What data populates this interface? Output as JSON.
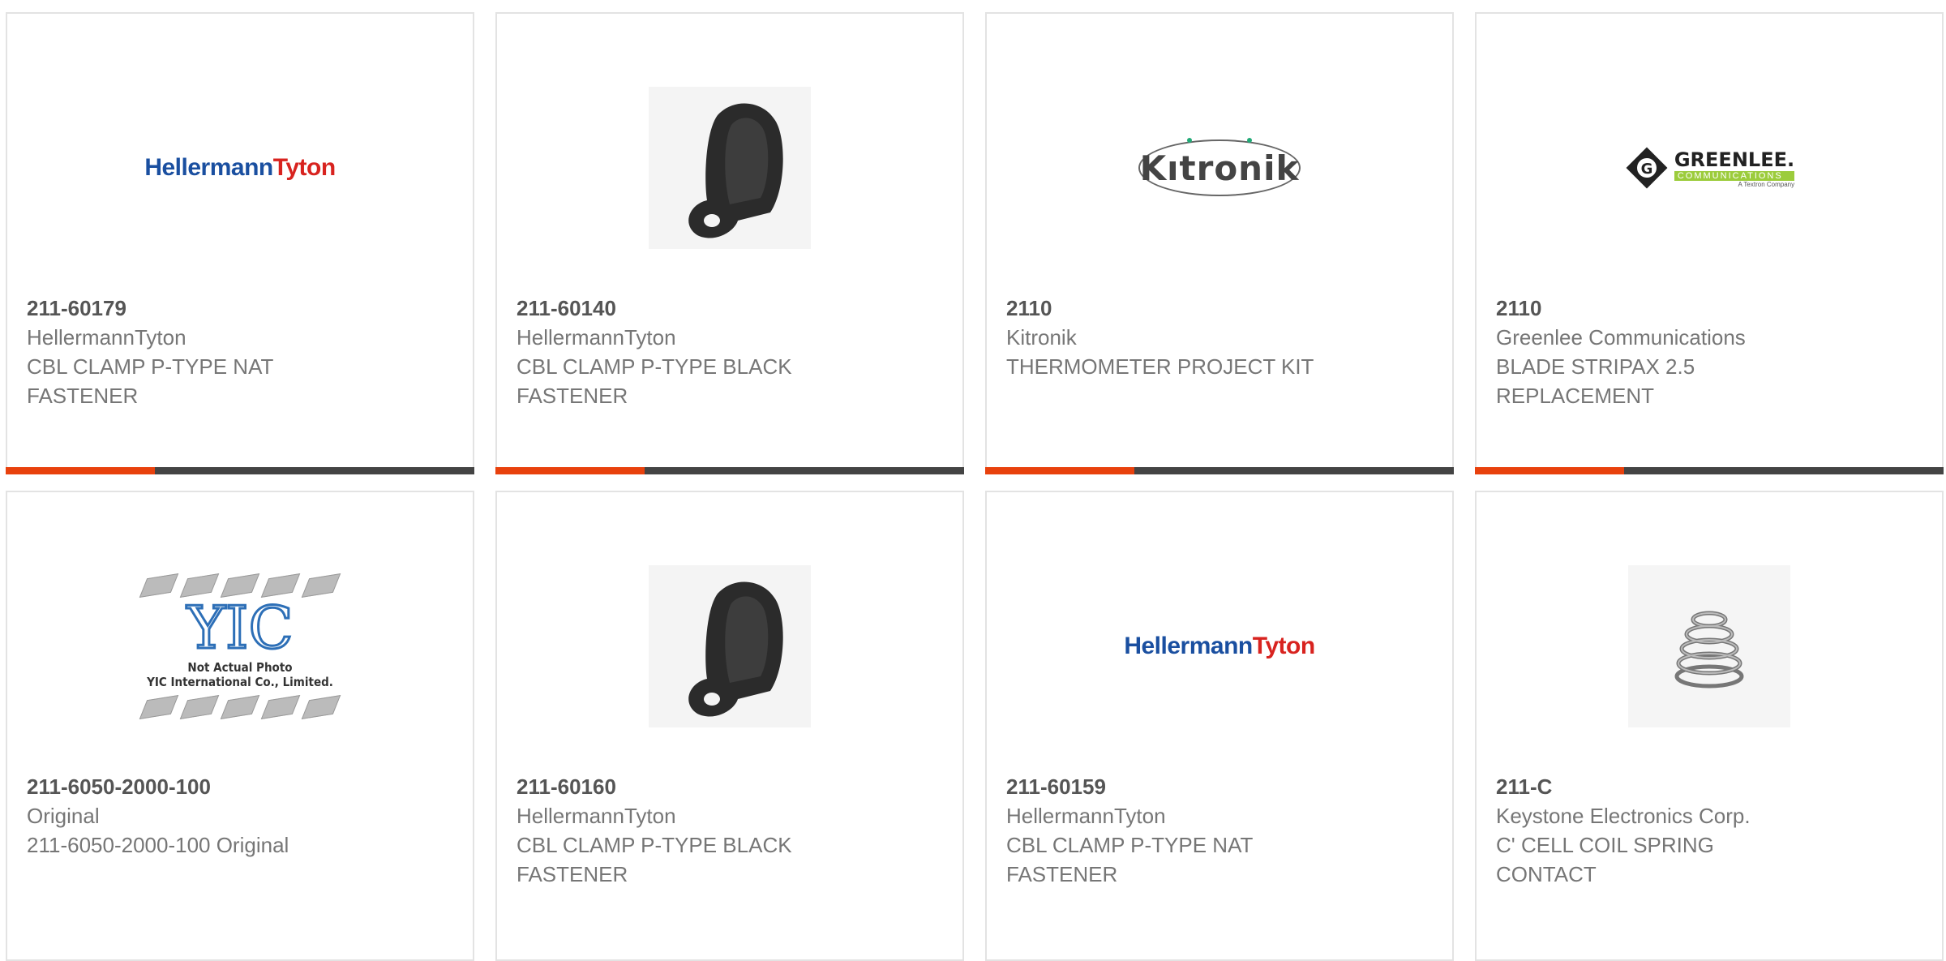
{
  "colors": {
    "accent": "#e8410d",
    "bar": "#444444"
  },
  "products": [
    {
      "part_number": "211-60179",
      "manufacturer": "HellermannTyton",
      "description_1": "CBL CLAMP P-TYPE NAT",
      "description_2": "FASTENER",
      "image": "hellermanntyton-logo",
      "logo_text_1": "Hellermann",
      "logo_text_2": "Tyton"
    },
    {
      "part_number": "211-60140",
      "manufacturer": "HellermannTyton",
      "description_1": "CBL CLAMP P-TYPE BLACK",
      "description_2": "FASTENER",
      "image": "black-p-clamp-photo"
    },
    {
      "part_number": "2110",
      "manufacturer": "Kitronik",
      "description_1": "THERMOMETER PROJECT KIT",
      "description_2": "",
      "image": "kitronik-logo",
      "logo_text": "Kıtronik"
    },
    {
      "part_number": "2110",
      "manufacturer": "Greenlee Communications",
      "description_1": "BLADE STRIPAX 2.5",
      "description_2": "REPLACEMENT",
      "image": "greenlee-logo",
      "logo_text": "GREENLEE.",
      "logo_sub": "COMMUNICATIONS",
      "logo_tiny": "A Textron Company"
    },
    {
      "part_number": "211-6050-2000-100",
      "manufacturer": "Original",
      "description_1": "211-6050-2000-100 Original",
      "description_2": "",
      "image": "yic-placeholder",
      "logo_text": "YIC",
      "note_1": "Not Actual Photo",
      "note_2": "YIC International Co., Limited."
    },
    {
      "part_number": "211-60160",
      "manufacturer": "HellermannTyton",
      "description_1": "CBL CLAMP P-TYPE BLACK",
      "description_2": "FASTENER",
      "image": "black-p-clamp-photo"
    },
    {
      "part_number": "211-60159",
      "manufacturer": "HellermannTyton",
      "description_1": "CBL CLAMP P-TYPE NAT",
      "description_2": "FASTENER",
      "image": "hellermanntyton-logo",
      "logo_text_1": "Hellermann",
      "logo_text_2": "Tyton"
    },
    {
      "part_number": "211-C",
      "manufacturer": "Keystone Electronics Corp.",
      "description_1": "C' CELL COIL SPRING",
      "description_2": "CONTACT",
      "image": "coil-spring-photo"
    }
  ]
}
